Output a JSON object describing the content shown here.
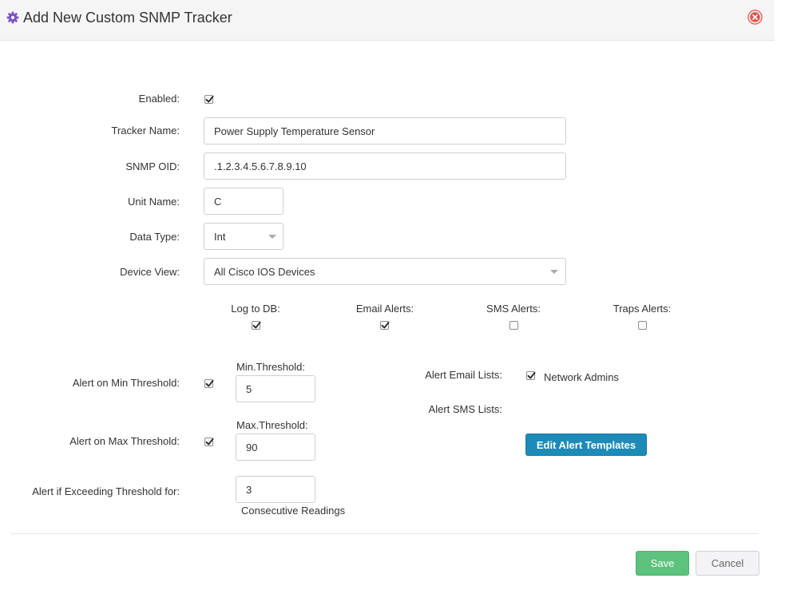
{
  "header": {
    "title": "Add New Custom SNMP Tracker",
    "gear_icon": "gear-icon",
    "close_icon": "close-circle-icon"
  },
  "form": {
    "enabled": {
      "label": "Enabled:",
      "checked": true
    },
    "tracker_name": {
      "label": "Tracker Name:",
      "value": "Power Supply Temperature Sensor"
    },
    "snmp_oid": {
      "label": "SNMP OID:",
      "value": ".1.2.3.4.5.6.7.8.9.10"
    },
    "unit_name": {
      "label": "Unit Name:",
      "value": "C"
    },
    "data_type": {
      "label": "Data Type:",
      "value": "Int"
    },
    "device_view": {
      "label": "Device View:",
      "value": "All Cisco IOS Devices"
    },
    "options": [
      {
        "label": "Log to DB:",
        "checked": true
      },
      {
        "label": "Email Alerts:",
        "checked": true
      },
      {
        "label": "SMS Alerts:",
        "checked": false
      },
      {
        "label": "Traps Alerts:",
        "checked": false
      }
    ],
    "alert_min": {
      "label": "Alert on Min Threshold:",
      "checked": true,
      "threshold_label": "Min.Threshold:",
      "threshold_value": "5"
    },
    "alert_max": {
      "label": "Alert on Max Threshold:",
      "checked": true,
      "threshold_label": "Max.Threshold:",
      "threshold_value": "90"
    },
    "exceeding": {
      "label": "Alert if Exceeding Threshold for:",
      "value": "3",
      "suffix": "Consecutive Readings"
    },
    "email_lists": {
      "label": "Alert Email Lists:",
      "items": [
        {
          "label": "Network Admins",
          "checked": true
        }
      ]
    },
    "sms_lists": {
      "label": "Alert SMS Lists:"
    },
    "edit_templates_label": "Edit Alert Templates"
  },
  "footer": {
    "save_label": "Save",
    "cancel_label": "Cancel"
  },
  "colors": {
    "accent": "#1c8bb8",
    "save": "#5cc27e",
    "gear": "#7b52c9",
    "close": "#e0554f"
  }
}
